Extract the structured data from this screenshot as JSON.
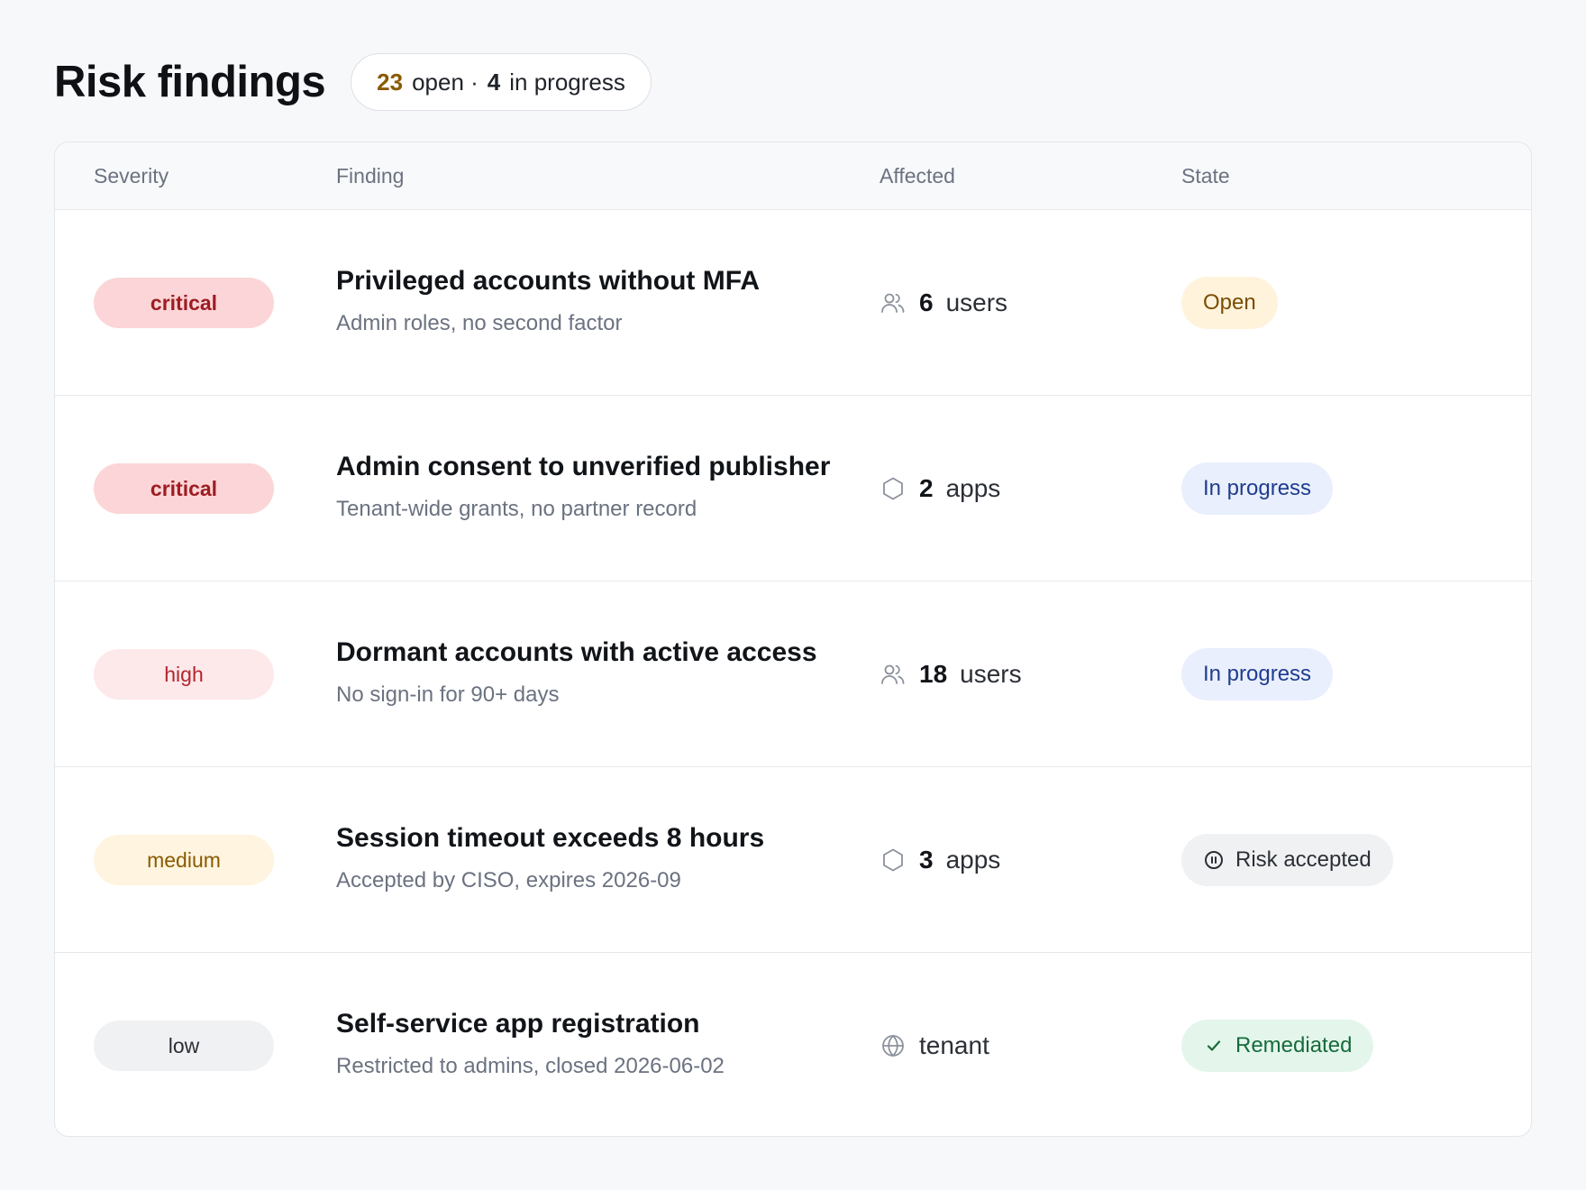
{
  "header": {
    "title": "Risk findings",
    "summary": {
      "open_count": "23",
      "open_label": "open ·",
      "progress_count": "4",
      "progress_label": "in progress"
    }
  },
  "table": {
    "columns": {
      "severity": "Severity",
      "finding": "Finding",
      "affected": "Affected",
      "state": "State"
    },
    "rows": [
      {
        "severity": "critical",
        "title": "Privileged accounts without MFA",
        "subtitle": "Admin roles, no second factor",
        "affected_icon": "users-icon",
        "affected_count": "6",
        "affected_unit": "users",
        "state": "Open"
      },
      {
        "severity": "critical",
        "title": "Admin consent to unverified publisher",
        "subtitle": "Tenant-wide grants, no partner record",
        "affected_icon": "app-hexagon-icon",
        "affected_count": "2",
        "affected_unit": "apps",
        "state": "In progress"
      },
      {
        "severity": "high",
        "title": "Dormant accounts with active access",
        "subtitle": "No sign-in for 90+ days",
        "affected_icon": "users-icon",
        "affected_count": "18",
        "affected_unit": "users",
        "state": "In progress"
      },
      {
        "severity": "medium",
        "title": "Session timeout exceeds 8 hours",
        "subtitle": "Accepted by CISO, expires 2026-09",
        "affected_icon": "app-hexagon-icon",
        "affected_count": "3",
        "affected_unit": "apps",
        "state": "Risk accepted",
        "state_icon": "pause-circle-icon"
      },
      {
        "severity": "low",
        "title": "Self-service app registration",
        "subtitle": "Restricted to admins, closed 2026-06-02",
        "affected_icon": "globe-icon",
        "affected_count": "",
        "affected_unit": "tenant",
        "state": "Remediated",
        "state_icon": "check-icon"
      }
    ]
  },
  "colors": {
    "critical_bg": "#fbd5d7",
    "high_bg": "#fde8ea",
    "medium_bg": "#fff4df",
    "low_bg": "#f0f1f3",
    "open_state": "#fff3dc",
    "progress_state": "#e9effd",
    "remediated_state": "#e4f6ec"
  }
}
